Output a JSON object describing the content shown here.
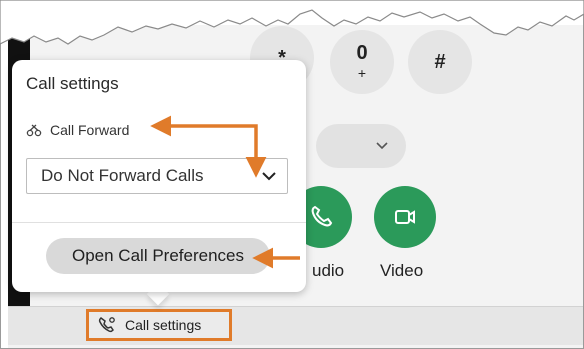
{
  "dialpad": {
    "keys": [
      {
        "main": "*",
        "sub": ""
      },
      {
        "main": "0",
        "sub": "+"
      },
      {
        "main": "#",
        "sub": ""
      }
    ]
  },
  "actions": {
    "audio_label": "udio",
    "video_label": "Video",
    "accent_color": "#2b9a5a"
  },
  "popup": {
    "title": "Call settings",
    "call_forward_label": "Call Forward",
    "call_forward_icon": "call-forward-icon",
    "forward_select_value": "Do Not Forward Calls",
    "open_preferences_label": "Open Call Preferences"
  },
  "bottom_bar": {
    "call_settings_label": "Call settings",
    "call_settings_icon": "phone-settings-icon"
  },
  "annotation": {
    "arrow_color": "#e07b2a"
  }
}
